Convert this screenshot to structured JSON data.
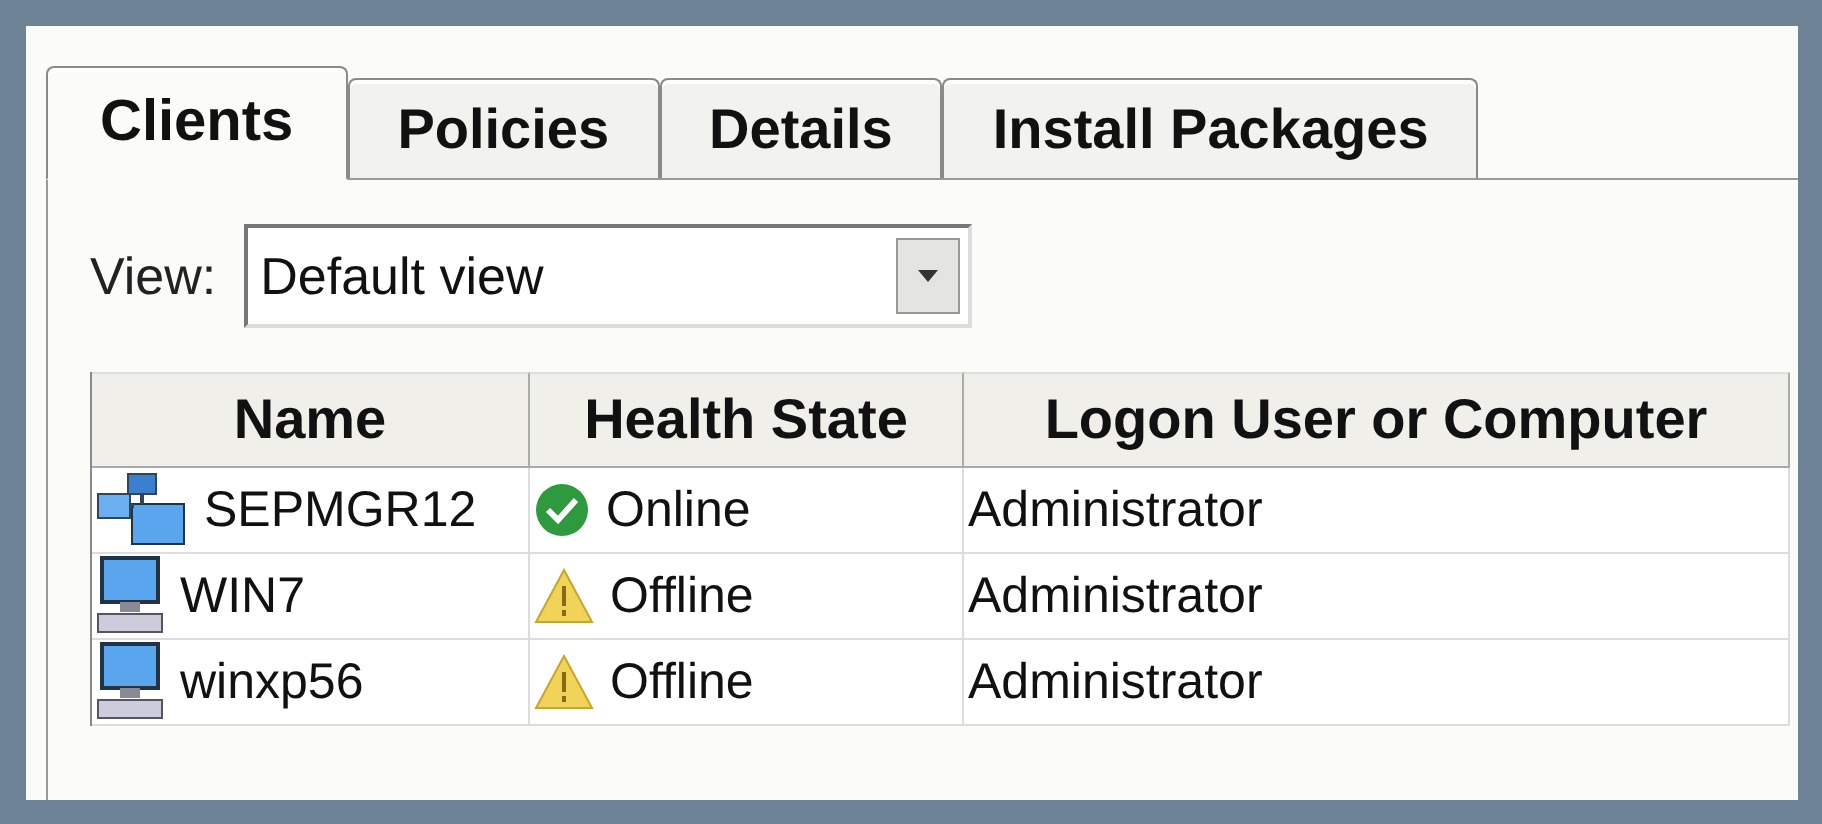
{
  "tabs": [
    {
      "label": "Clients",
      "selected": true
    },
    {
      "label": "Policies",
      "selected": false
    },
    {
      "label": "Details",
      "selected": false
    },
    {
      "label": "Install Packages",
      "selected": false
    }
  ],
  "view": {
    "label": "View:",
    "value": "Default view"
  },
  "table": {
    "columns": [
      "Name",
      "Health State",
      "Logon User or Computer"
    ],
    "rows": [
      {
        "kind": "server",
        "name": "SEPMGR12",
        "health": {
          "kind": "online",
          "text": "Online"
        },
        "logon": "Administrator"
      },
      {
        "kind": "computer",
        "name": "WIN7",
        "health": {
          "kind": "offline",
          "text": "Offline"
        },
        "logon": "Administrator"
      },
      {
        "kind": "computer",
        "name": "winxp56",
        "health": {
          "kind": "offline",
          "text": "Offline"
        },
        "logon": "Administrator"
      }
    ]
  }
}
